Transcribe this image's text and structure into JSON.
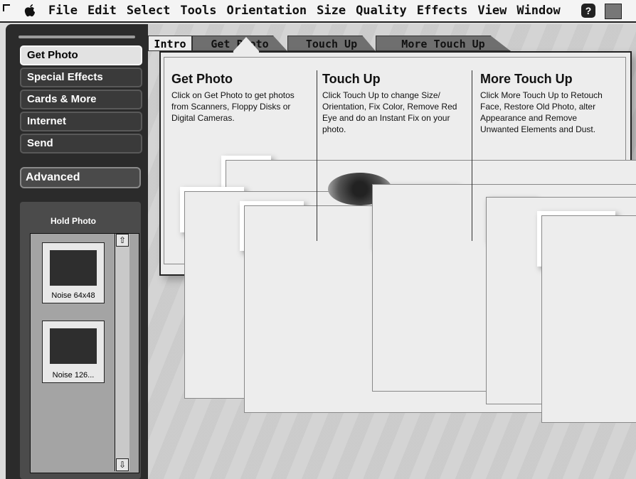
{
  "menubar": {
    "items": [
      "File",
      "Edit",
      "Select",
      "Tools",
      "Orientation",
      "Size",
      "Quality",
      "Effects",
      "View",
      "Window"
    ],
    "help": "?"
  },
  "sidebar": {
    "nav": [
      "Get Photo",
      "Special Effects",
      "Cards & More",
      "Internet",
      "Send"
    ],
    "advanced": "Advanced",
    "hold_title": "Hold Photo",
    "thumbs": [
      "Noise 64x48",
      "Noise 126..."
    ]
  },
  "tabs": [
    "Intro",
    "Get Photo",
    "Touch Up",
    "More Touch Up"
  ],
  "content": {
    "sections": [
      {
        "title": "Get Photo",
        "body": "Click on Get Photo to get photos from Scanners, Floppy Disks or Digital Cameras."
      },
      {
        "title": "Touch Up",
        "body": "Click Touch Up to change Size/ Orientation, Fix Color, Remove Red Eye and do an Instant Fix on your photo."
      },
      {
        "title": "More Touch Up",
        "body": "Click More Touch Up to Retouch Face, Restore Old Photo, alter Appearance and Remove Unwanted Elements and Dust."
      }
    ]
  }
}
